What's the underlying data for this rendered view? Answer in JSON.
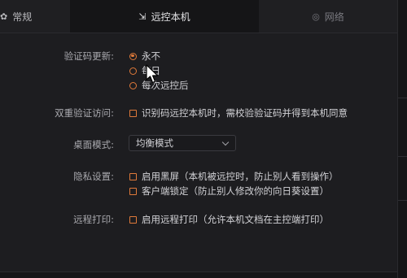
{
  "tabs": {
    "general": "常规",
    "remote": "远控本机",
    "network": "网络"
  },
  "settings": {
    "verify_code_update": {
      "label": "验证码更新:",
      "options": [
        "永不",
        "每日",
        "每次远控后"
      ]
    },
    "two_factor": {
      "label": "双重验证访问:",
      "option": "识别码远控本机时，需校验验证码并得到本机同意"
    },
    "desktop_mode": {
      "label": "桌面模式:",
      "value": "均衡模式"
    },
    "privacy": {
      "label": "隐私设置:",
      "options": [
        "启用黑屏（本机被远控时，防止别人看到操作）",
        "客户端锁定（防止别人修改你的向日葵设置）"
      ]
    },
    "remote_print": {
      "label": "远程打印:",
      "option": "启用远程打印（允许本机文档在主控端打印）"
    }
  },
  "colors": {
    "accent": "#e07a3a",
    "background": "#1d1d20"
  }
}
